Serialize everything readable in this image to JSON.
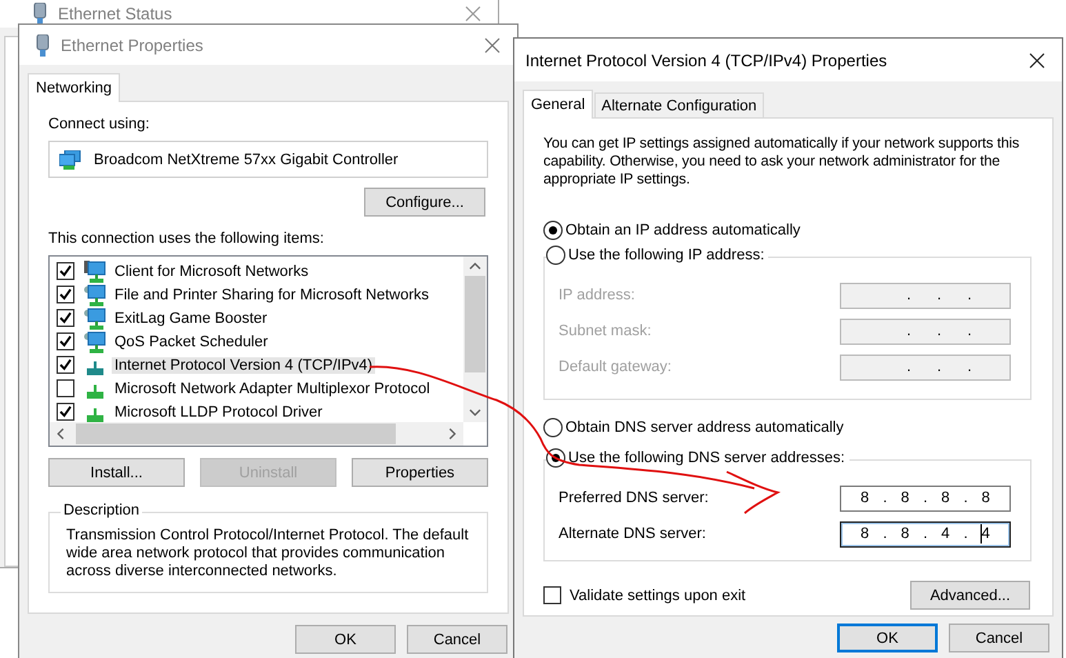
{
  "background_window": {
    "title": "Ethernet Status"
  },
  "ethernet_properties": {
    "title": "Ethernet Properties",
    "tabs": [
      {
        "label": "Networking",
        "selected": true
      }
    ],
    "connect_using_label": "Connect using:",
    "adapter": "Broadcom NetXtreme 57xx Gigabit Controller",
    "configure_button": "Configure...",
    "items_label": "This connection uses the following items:",
    "items": [
      {
        "label": "Client for Microsoft Networks",
        "checked": true,
        "kind": "client",
        "selected": false
      },
      {
        "label": "File and Printer Sharing for Microsoft Networks",
        "checked": true,
        "kind": "service",
        "selected": false
      },
      {
        "label": "ExitLag Game Booster",
        "checked": true,
        "kind": "service",
        "selected": false
      },
      {
        "label": "QoS Packet Scheduler",
        "checked": true,
        "kind": "service",
        "selected": false
      },
      {
        "label": "Internet Protocol Version 4 (TCP/IPv4)",
        "checked": true,
        "kind": "protocol",
        "selected": true
      },
      {
        "label": "Microsoft Network Adapter Multiplexor Protocol",
        "checked": false,
        "kind": "protocol",
        "selected": false
      },
      {
        "label": "Microsoft LLDP Protocol Driver",
        "checked": true,
        "kind": "protocol",
        "selected": false
      }
    ],
    "buttons": [
      {
        "label": "Install...",
        "disabled": false
      },
      {
        "label": "Uninstall",
        "disabled": true
      },
      {
        "label": "Properties",
        "disabled": false
      }
    ],
    "description": {
      "title": "Description",
      "text": "Transmission Control Protocol/Internet Protocol. The default wide area network protocol that provides communication across diverse interconnected networks."
    },
    "dialog_buttons": [
      {
        "label": "OK",
        "focused": false
      },
      {
        "label": "Cancel",
        "focused": false
      }
    ]
  },
  "ipv4_properties": {
    "title": "Internet Protocol Version 4 (TCP/IPv4) Properties",
    "tabs": [
      {
        "label": "General",
        "selected": true
      },
      {
        "label": "Alternate Configuration",
        "selected": false
      }
    ],
    "intro": "You can get IP settings assigned automatically if your network supports this capability. Otherwise, you need to ask your network administrator for the appropriate IP settings.",
    "ip_modes": [
      {
        "label": "Obtain an IP address automatically",
        "selected": true
      },
      {
        "label": "Use the following IP address:",
        "selected": false
      }
    ],
    "ip_fields": [
      {
        "label": "IP address:",
        "disabled": true,
        "focused": false,
        "parts": [
          ".",
          ".",
          "."
        ]
      },
      {
        "label": "Subnet mask:",
        "disabled": true,
        "focused": false,
        "parts": [
          ".",
          ".",
          "."
        ]
      },
      {
        "label": "Default gateway:",
        "disabled": true,
        "focused": false,
        "parts": [
          ".",
          ".",
          "."
        ]
      }
    ],
    "dns_modes": [
      {
        "label": "Obtain DNS server address automatically",
        "selected": false
      },
      {
        "label": "Use the following DNS server addresses:",
        "selected": true
      }
    ],
    "dns_fields": [
      {
        "label": "Preferred DNS server:",
        "disabled": false,
        "focused": false,
        "parts": [
          "8",
          ".",
          "8",
          ".",
          "8",
          ".",
          "8"
        ]
      },
      {
        "label": "Alternate DNS server:",
        "disabled": false,
        "focused": true,
        "parts": [
          "8",
          ".",
          "8",
          ".",
          "4",
          ".",
          "4"
        ]
      }
    ],
    "validate": {
      "label": "Validate settings upon exit",
      "checked": false
    },
    "advanced_button": "Advanced...",
    "dialog_buttons": [
      {
        "label": "OK",
        "focused": true
      },
      {
        "label": "Cancel",
        "focused": false
      }
    ]
  }
}
